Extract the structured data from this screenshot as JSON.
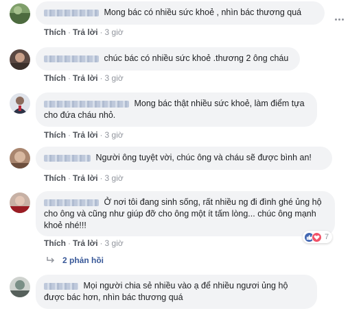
{
  "comments": [
    {
      "text": "Mong bác có nhiều sức khoẻ , nhìn bác thương quá",
      "actions": {
        "like": "Thích",
        "reply": "Trả lời",
        "time": "3 giờ"
      }
    },
    {
      "text": "chúc bác có nhiều sức khoẻ .thương 2 ông cháu",
      "actions": {
        "like": "Thích",
        "reply": "Trả lời",
        "time": "3 giờ"
      }
    },
    {
      "text": "Mong bác thật nhiều sức khoẻ, làm điểm tựa cho đứa cháu nhỏ.",
      "actions": {
        "like": "Thích",
        "reply": "Trả lời",
        "time": "3 giờ"
      }
    },
    {
      "text": "Người ông tuyệt vời, chúc ông và cháu sẽ được bình an!",
      "actions": {
        "like": "Thích",
        "reply": "Trả lời",
        "time": "3 giờ"
      }
    },
    {
      "text": "Ở nơi tôi đang sinh sống, rất nhiều ng đi đình ghé ủng hộ cho ông và cũng như giúp đỡ cho ông một ít tấm lòng... chúc ông mạnh khoẻ nhé!!!",
      "actions": {
        "like": "Thích",
        "reply": "Trả lời",
        "time": "3 giờ"
      },
      "reactions": {
        "count": "7",
        "types": [
          "like-icon",
          "love-icon"
        ]
      }
    },
    {
      "text": "Mọi người chia sẻ nhiều vào ạ để nhiều ngươi ủng hộ được bác hơn, nhìn bác thương quá",
      "actions": {}
    }
  ],
  "replies_link": "2 phản hồi",
  "colors": {
    "bubble": "#f2f3f5",
    "link": "#385898",
    "like": "#4267b2",
    "love": "#f25268",
    "meta": "#90949c"
  }
}
